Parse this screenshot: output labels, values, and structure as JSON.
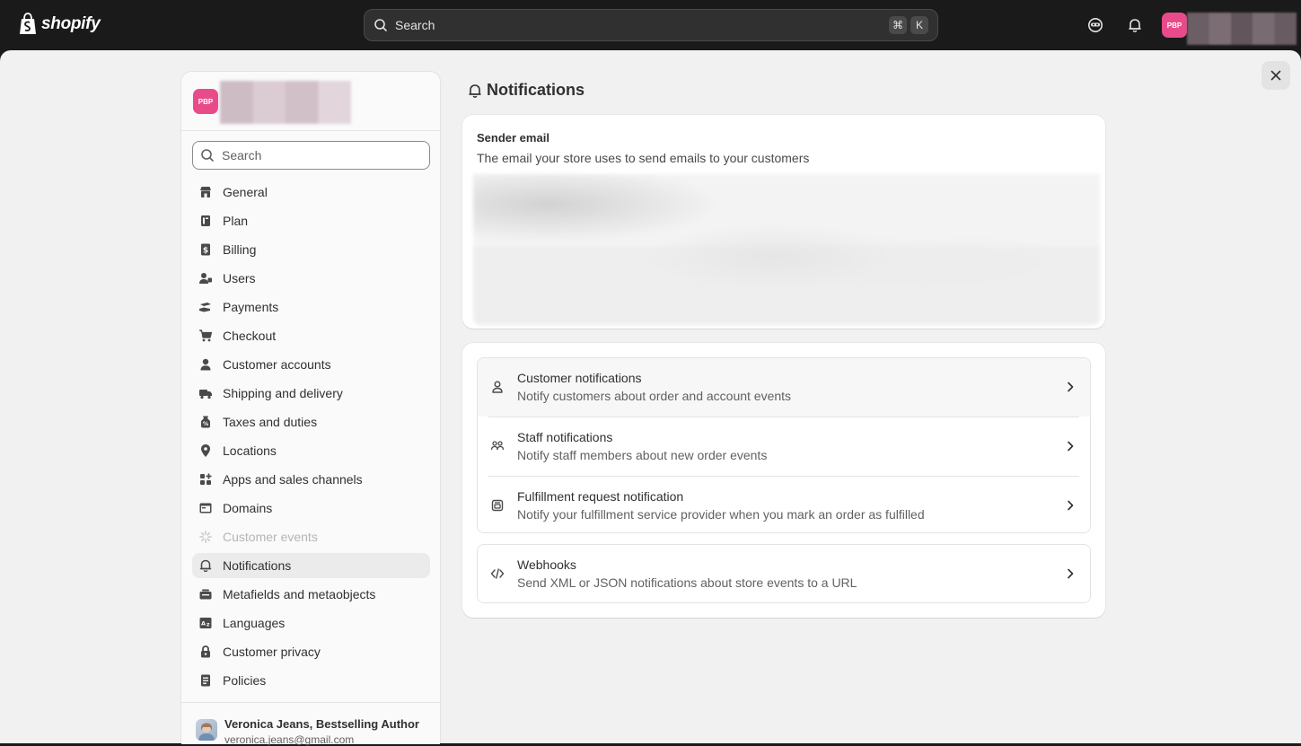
{
  "topbar": {
    "logo_text": "shopify",
    "search_placeholder": "Search",
    "shortcut_keys": [
      "⌘",
      "K"
    ],
    "store_badge": "PBP"
  },
  "sidebar": {
    "store_badge": "PBP",
    "search_placeholder": "Search",
    "items": [
      {
        "label": "General",
        "icon": "store-icon"
      },
      {
        "label": "Plan",
        "icon": "plan-icon"
      },
      {
        "label": "Billing",
        "icon": "billing-icon"
      },
      {
        "label": "Users",
        "icon": "users-icon"
      },
      {
        "label": "Payments",
        "icon": "payments-icon"
      },
      {
        "label": "Checkout",
        "icon": "cart-icon"
      },
      {
        "label": "Customer accounts",
        "icon": "person-icon"
      },
      {
        "label": "Shipping and delivery",
        "icon": "truck-icon"
      },
      {
        "label": "Taxes and duties",
        "icon": "tax-icon"
      },
      {
        "label": "Locations",
        "icon": "location-icon"
      },
      {
        "label": "Apps and sales channels",
        "icon": "apps-icon"
      },
      {
        "label": "Domains",
        "icon": "domains-icon"
      },
      {
        "label": "Customer events",
        "icon": "customer-events-icon"
      },
      {
        "label": "Notifications",
        "icon": "bell-icon"
      },
      {
        "label": "Metafields and metaobjects",
        "icon": "metafields-icon"
      },
      {
        "label": "Languages",
        "icon": "languages-icon"
      },
      {
        "label": "Customer privacy",
        "icon": "lock-icon"
      },
      {
        "label": "Policies",
        "icon": "policies-icon"
      }
    ],
    "user": {
      "name": "Veronica Jeans, Bestselling Author",
      "email": "veronica.jeans@gmail.com"
    }
  },
  "page": {
    "title": "Notifications",
    "sender_email": {
      "heading": "Sender email",
      "description": "The email your store uses to send emails to your customers"
    },
    "rows": [
      {
        "title": "Customer notifications",
        "description": "Notify customers about order and account events",
        "icon": "person-icon"
      },
      {
        "title": "Staff notifications",
        "description": "Notify staff members about new order events",
        "icon": "staff-icon"
      },
      {
        "title": "Fulfillment request notification",
        "description": "Notify your fulfillment service provider when you mark an order as fulfilled",
        "icon": "fulfillment-icon"
      }
    ],
    "webhooks": {
      "title": "Webhooks",
      "description": "Send XML or JSON notifications about store events to a URL",
      "icon": "code-icon"
    }
  },
  "colors": {
    "topbar_bg": "#1a1a1a",
    "page_bg": "#f1f1f1",
    "brand_badge": "#e94b8a",
    "active_nav": "#ebebeb"
  }
}
